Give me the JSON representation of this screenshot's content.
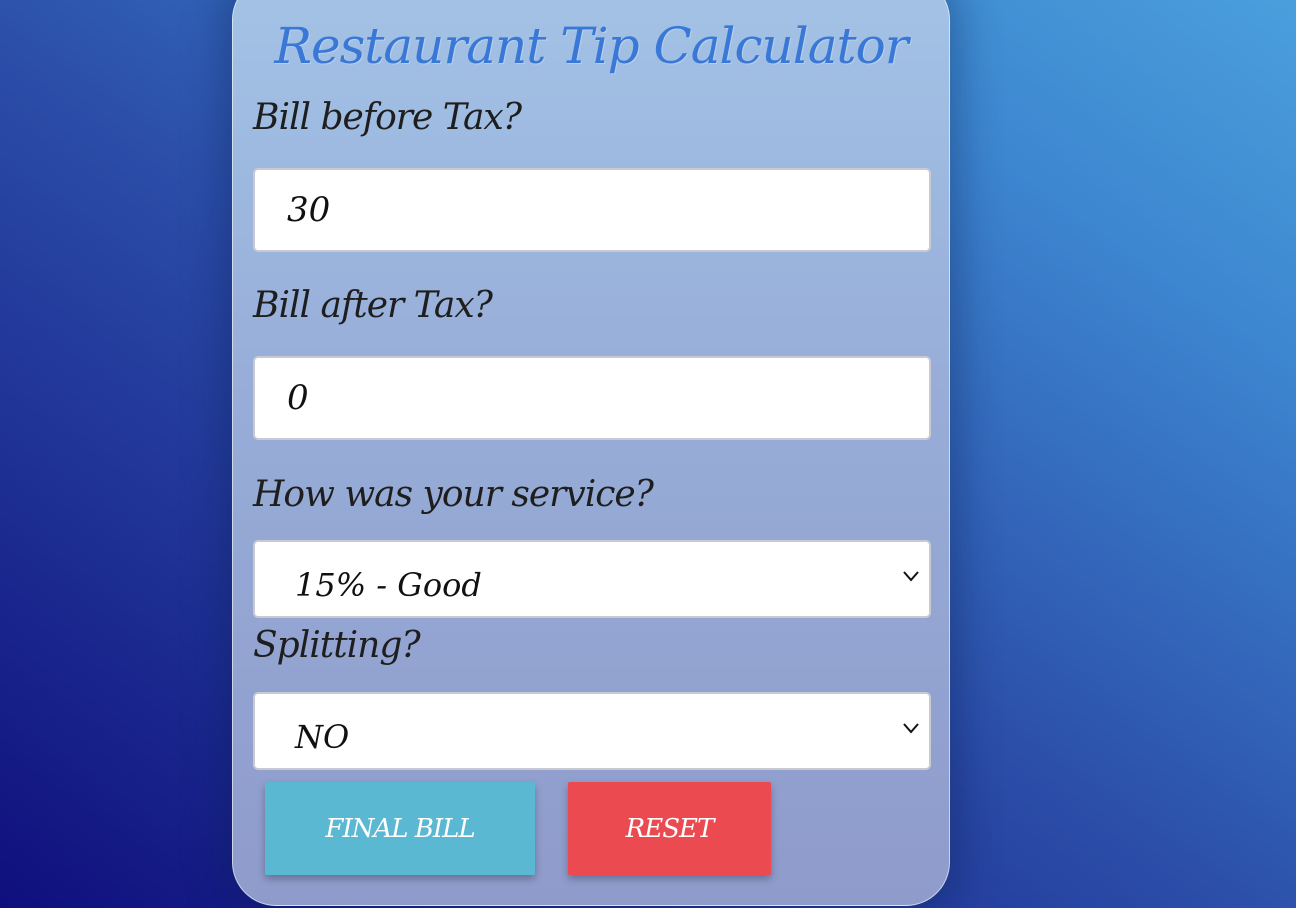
{
  "app": {
    "title": "Restaurant Tip Calculator"
  },
  "form": {
    "bill_before_tax_label": "Bill before Tax?",
    "bill_before_tax_value": "30",
    "bill_after_tax_label": "Bill after Tax?",
    "bill_after_tax_value": "0",
    "service_label": "How was your service?",
    "service_selected": "15% - Good",
    "splitting_label": "Splitting?",
    "splitting_selected": "NO"
  },
  "buttons": {
    "final_bill_label": "FINAL BILL",
    "reset_label": "RESET"
  },
  "colors": {
    "title": "#3a78d8",
    "final_bill_button": "#5bb8d3",
    "reset_button": "#ea4a50"
  },
  "icons": {
    "select_arrow": "chevron-down-icon"
  }
}
